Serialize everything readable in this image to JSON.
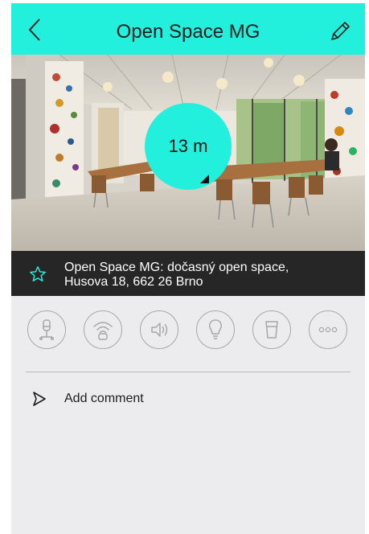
{
  "header": {
    "title": "Open Space MG",
    "back_icon": "chevron-left-icon",
    "edit_icon": "pencil-icon",
    "accent_color": "#22f0dd"
  },
  "photo": {
    "distance": "13 m",
    "direction_icon": "navigation-arrow-icon"
  },
  "place": {
    "address_line1": "Open Space MG: dočasný open space,",
    "address_line2": "Husova 18, 662 26 Brno",
    "favorite_icon": "star-outline-icon"
  },
  "amenities": [
    {
      "icon": "desk-chair-icon"
    },
    {
      "icon": "wifi-icon"
    },
    {
      "icon": "speaker-volume-icon"
    },
    {
      "icon": "lightbulb-icon"
    },
    {
      "icon": "drink-cup-icon"
    },
    {
      "icon": "more-dots-icon"
    }
  ],
  "comment": {
    "label": "Add comment",
    "icon": "send-icon"
  }
}
